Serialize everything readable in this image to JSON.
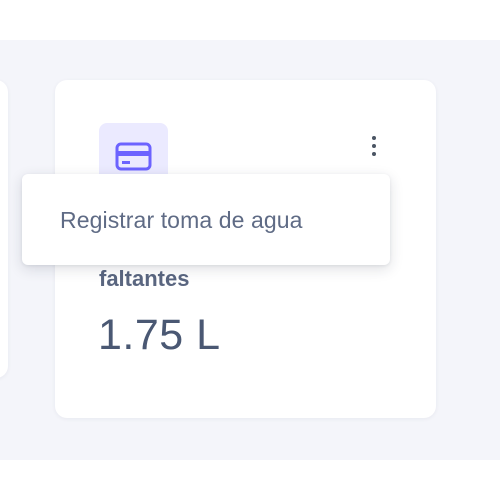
{
  "card": {
    "icon": "credit-card-icon",
    "metric_label": "faltantes",
    "metric_value": "1.75 L"
  },
  "menu": {
    "items": [
      {
        "label": "Registrar toma de agua"
      }
    ]
  },
  "colors": {
    "accent": "#6c63ff",
    "icon_bg": "#ebeaff",
    "page_bg": "#f4f5fa",
    "text": "#5a6680"
  }
}
